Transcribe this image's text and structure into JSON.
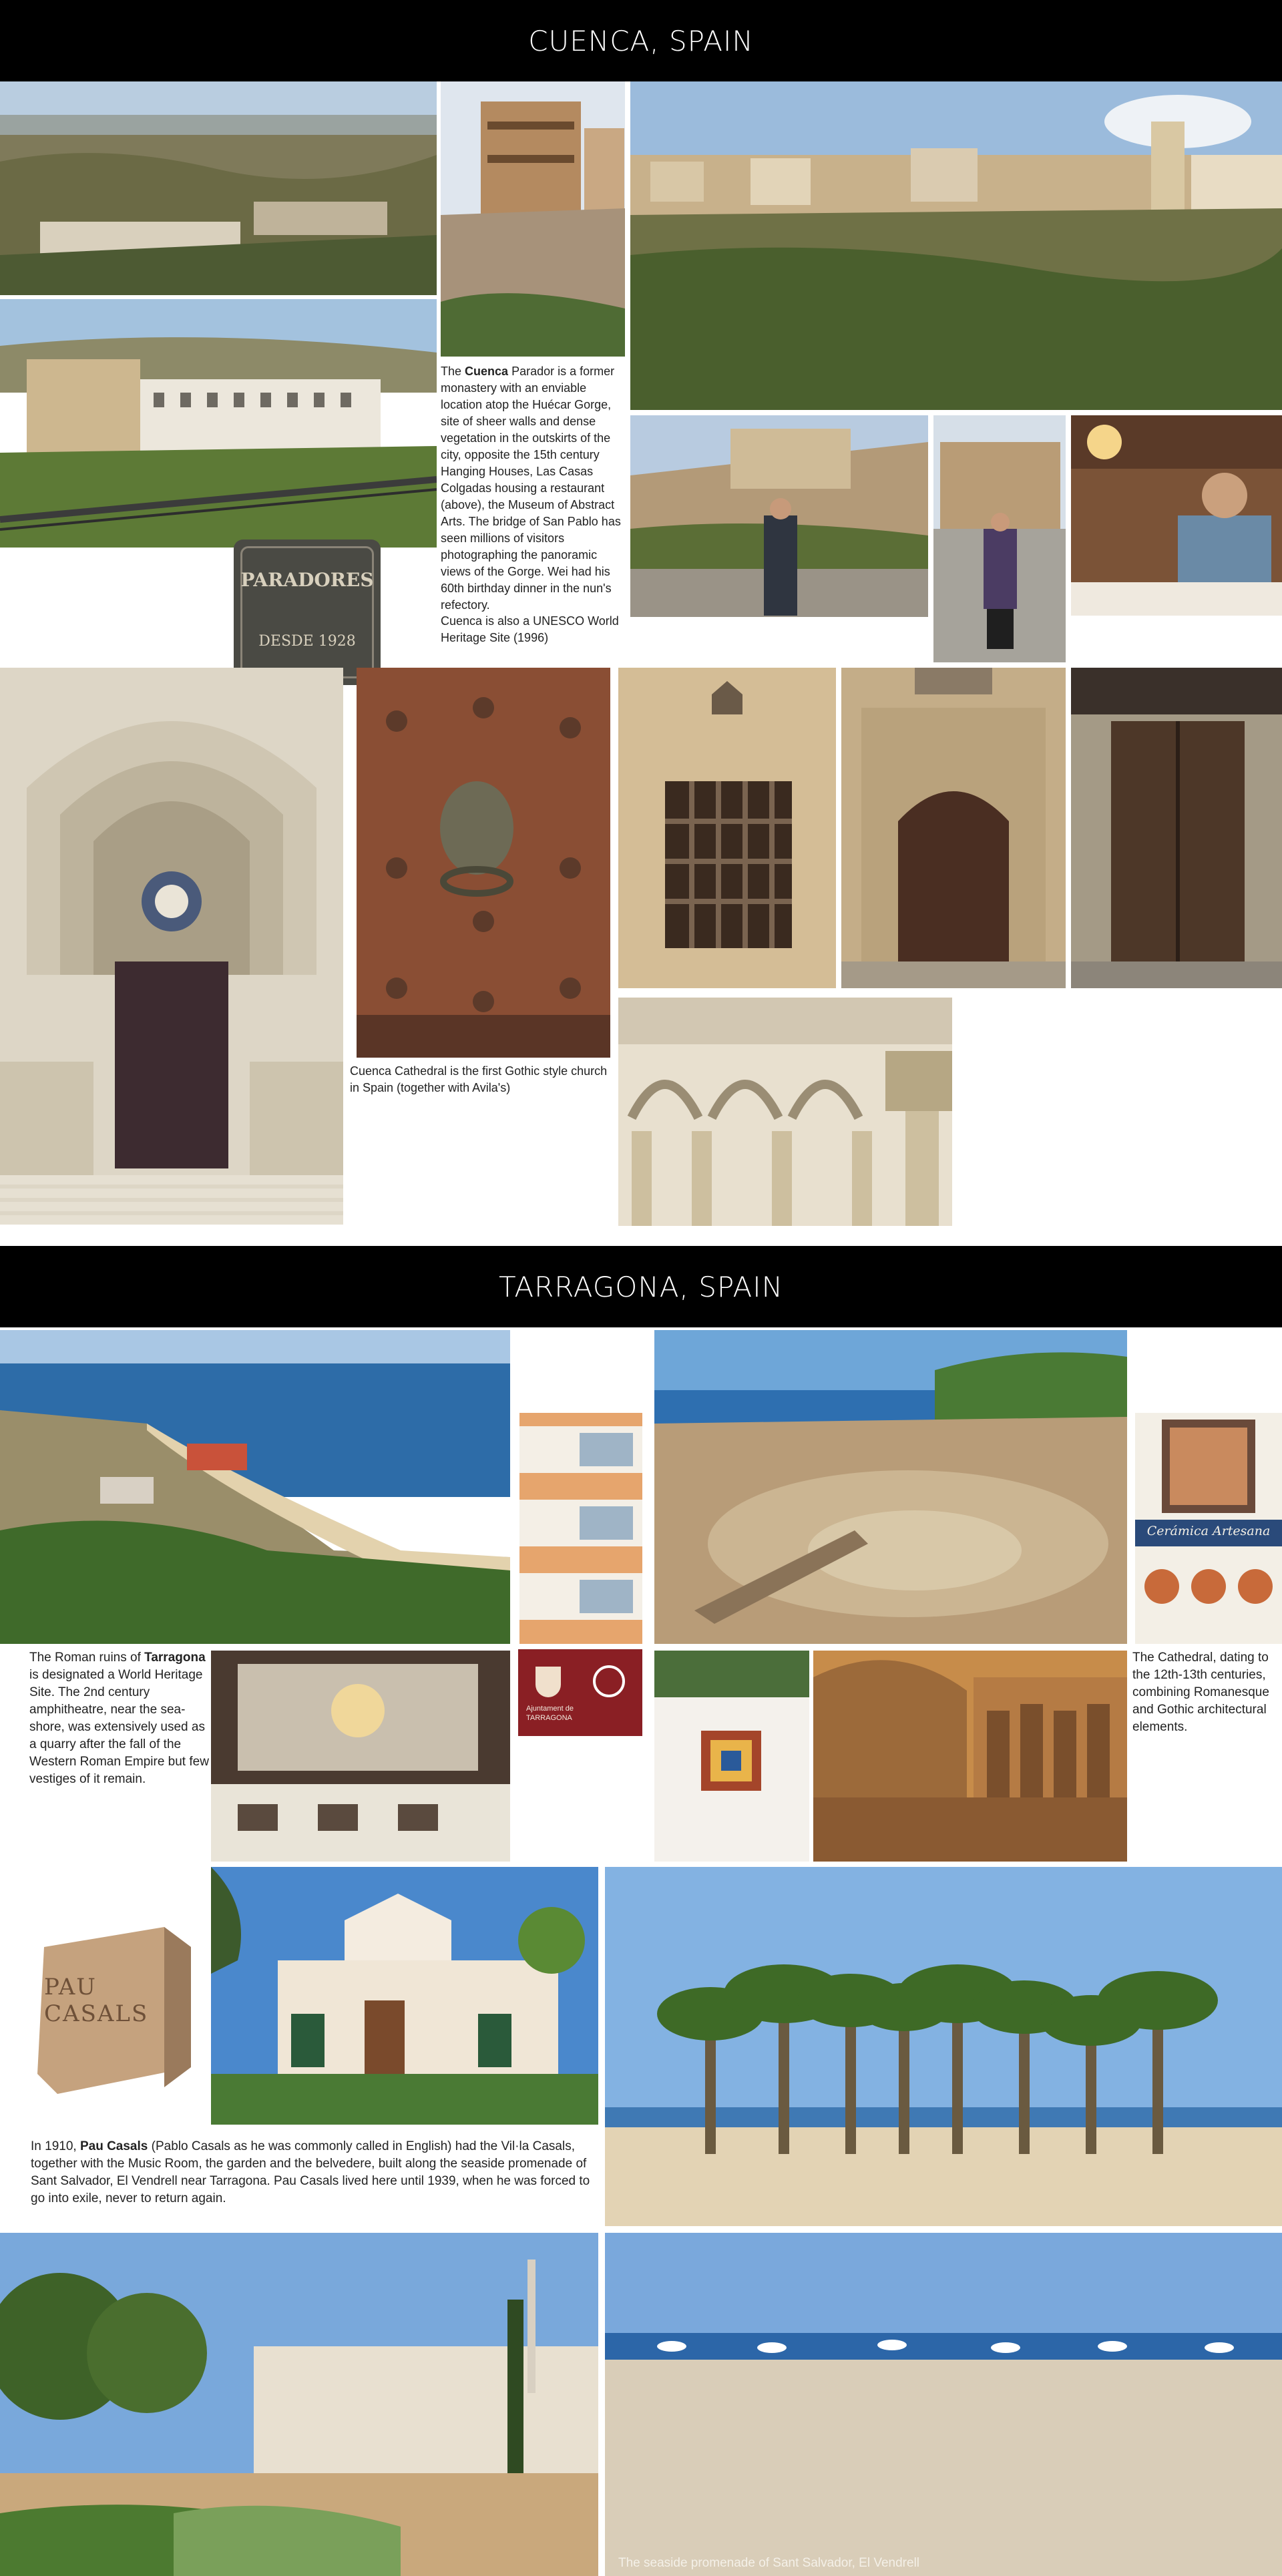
{
  "cuenca": {
    "title": "CUENCA, SPAIN",
    "parador_caption": {
      "p1": "The",
      "place": "Cuenca",
      "p2": "Parador is a former monastery with an enviable location atop the Huécar Gorge, site of sheer walls and dense vegetation in the outskirts of the city, opposite the 15th century Hanging Houses, Las Casas Colgadas housing a restaurant (above), the Museum of Abstract Arts. The bridge of San Pablo has seen millions of visitors photographing the panoramic views of the Gorge. Wei had his 60th birthday dinner in the nun's refectory.",
      "unesco": "Cuenca is also a UNESCO World Heritage Site (1996)"
    },
    "sign": {
      "line1": "PARADORES",
      "line2": "DESDE 1928"
    },
    "cathedral_caption": "Cuenca Cathedral is the first Gothic style church in Spain (together with Avila's)"
  },
  "tarragona": {
    "title": "TARRAGONA, SPAIN",
    "ruins_caption": {
      "p1": "The Roman ruins of",
      "place": "Tarragona",
      "p2": "is designated a World Heritage Site. The 2nd century amphitheatre, near the sea-shore, was extensively used as a quarry after the fall of the Western Roman Empire but few vestiges of it remain."
    },
    "cathedral_caption": "The Cathedral, dating to the 12th-13th centuries, combining Romanesque and Gothic architectural elements.",
    "tile_sign": "Cerámica Artesana",
    "ajuntament": {
      "line1": "Ajuntament de",
      "line2": "TARRAGONA"
    },
    "casals_block": "PAU CASALS",
    "casals_caption": {
      "p1": "In 1910,",
      "name": "Pau Casals",
      "p2": "(Pablo Casals as he was commonly called in English) had the Vil·la Casals, together with the Music Room, the garden and the belvedere, built along the seaside promenade of Sant Salvador, El Vendrell near Tarragona. Pau Casals lived here until 1939, when he was forced to go into exile, never to return again."
    },
    "beach_caption": "The seaside promenade of Sant Salvador, El Vendrell"
  },
  "colors": {
    "band": "#000000",
    "sky": "#8fb3d6",
    "stone": "#c9b48e",
    "sea": "#2c6fa8",
    "sand": "#e3d3b4"
  }
}
